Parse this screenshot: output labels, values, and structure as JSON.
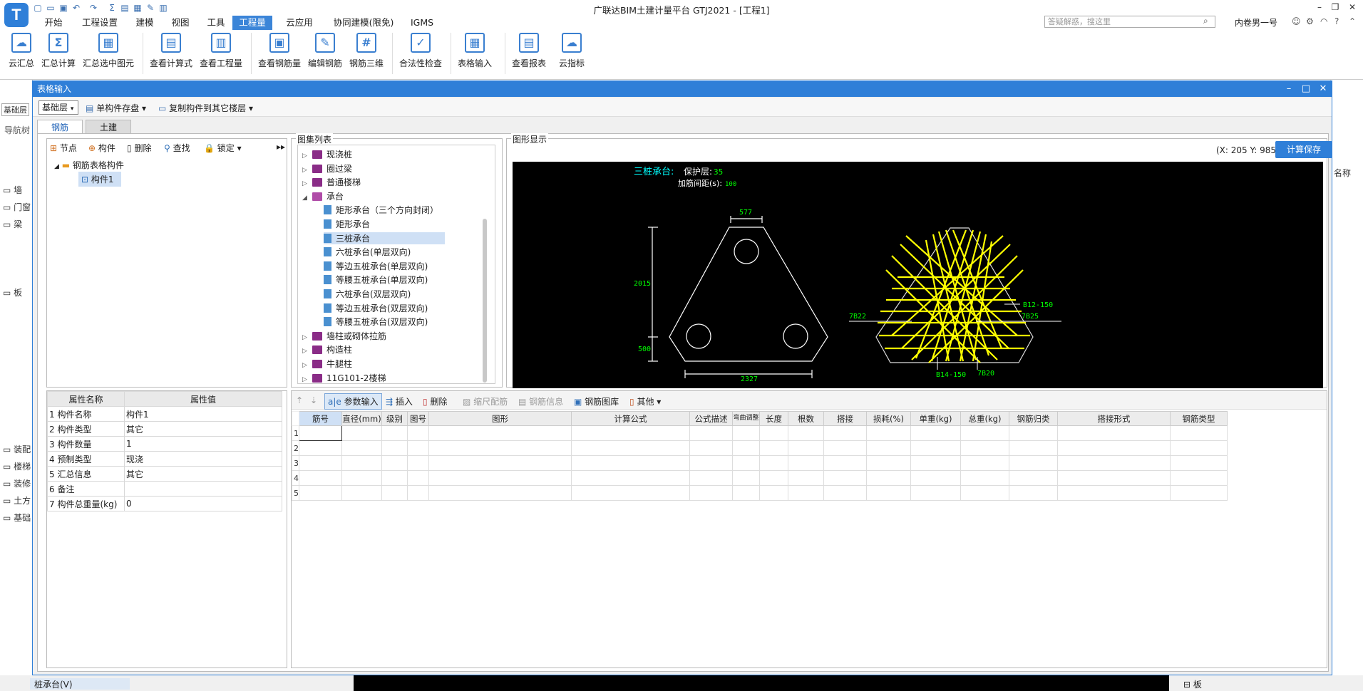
{
  "app": {
    "title": "广联达BIM土建计量平台 GTJ2021 - [工程1]",
    "logo_letter": "T",
    "search_placeholder": "答疑解惑，搜这里",
    "user": "内卷男一号"
  },
  "menu_tabs": [
    "开始",
    "工程设置",
    "建模",
    "视图",
    "工具",
    "工程量",
    "云应用",
    "协同建模(限免)",
    "IGMS"
  ],
  "active_menu": "工程量",
  "ribbon": {
    "items": [
      {
        "label": "云汇总",
        "icon": "cloud-sum-icon"
      },
      {
        "label": "汇总计算",
        "icon": "sigma-icon"
      },
      {
        "label": "汇总选中图元",
        "icon": "sum-selected-icon"
      },
      {
        "label": "查看计算式",
        "icon": "view-formula-icon"
      },
      {
        "label": "查看工程量",
        "icon": "view-quantity-icon"
      },
      {
        "label": "查看钢筋量",
        "icon": "view-rebar-icon"
      },
      {
        "label": "编辑钢筋",
        "icon": "edit-rebar-icon"
      },
      {
        "label": "钢筋三维",
        "icon": "rebar-3d-icon"
      },
      {
        "label": "合法性检查",
        "icon": "check-icon"
      },
      {
        "label": "表格输入",
        "icon": "table-input-icon"
      },
      {
        "label": "查看报表",
        "icon": "report-icon"
      },
      {
        "label": "云指标",
        "icon": "cloud-index-icon"
      }
    ]
  },
  "background_left": {
    "layer": "基础层",
    "nav": "导航树",
    "items": [
      "墙",
      "门窗",
      "梁",
      "板",
      "装配",
      "楼梯",
      "装修",
      "土方",
      "基础"
    ],
    "bottom_item": "桩承台(V)"
  },
  "background_right": {
    "header": "名称",
    "bottom_item": "板"
  },
  "dialog": {
    "title": "表格输入",
    "layer": "基础层",
    "toolbar": [
      "单构件存盘",
      "复制构件到其它楼层"
    ],
    "tabs": [
      "钢筋",
      "土建"
    ],
    "active_tab": "钢筋",
    "tree_toolbar": [
      "节点",
      "构件",
      "删除",
      "查找",
      "锁定"
    ],
    "tree": {
      "root": "钢筋表格构件",
      "child": "构件1"
    },
    "properties": {
      "headers": [
        "属性名称",
        "属性值"
      ],
      "rows": [
        [
          "1 构件名称",
          "构件1"
        ],
        [
          "2 构件类型",
          "其它"
        ],
        [
          "3 构件数量",
          "1"
        ],
        [
          "4 预制类型",
          "现浇"
        ],
        [
          "5 汇总信息",
          "其它"
        ],
        [
          "6 备注",
          ""
        ],
        [
          "7 构件总重量(kg)",
          "0"
        ]
      ]
    },
    "atlas": {
      "title": "图集列表",
      "items": [
        {
          "label": "现浇桩",
          "level": 0,
          "type": "book"
        },
        {
          "label": "圈过梁",
          "level": 0,
          "type": "book"
        },
        {
          "label": "普通楼梯",
          "level": 0,
          "type": "book"
        },
        {
          "label": "承台",
          "level": 0,
          "type": "open"
        },
        {
          "label": "矩形承台（三个方向封闭）",
          "level": 1,
          "type": "page"
        },
        {
          "label": "矩形承台",
          "level": 1,
          "type": "page"
        },
        {
          "label": "三桩承台",
          "level": 1,
          "type": "page"
        },
        {
          "label": "六桩承台(单层双向)",
          "level": 1,
          "type": "page"
        },
        {
          "label": "等边五桩承台(单层双向)",
          "level": 1,
          "type": "page"
        },
        {
          "label": "等腰五桩承台(单层双向)",
          "level": 1,
          "type": "page"
        },
        {
          "label": "六桩承台(双层双向)",
          "level": 1,
          "type": "page"
        },
        {
          "label": "等边五桩承台(双层双向)",
          "level": 1,
          "type": "page"
        },
        {
          "label": "等腰五桩承台(双层双向)",
          "level": 1,
          "type": "page"
        },
        {
          "label": "墙柱或砌体拉筋",
          "level": 0,
          "type": "book"
        },
        {
          "label": "构造柱",
          "level": 0,
          "type": "book"
        },
        {
          "label": "牛腿柱",
          "level": 0,
          "type": "book"
        },
        {
          "label": "11G101-2楼梯",
          "level": 0,
          "type": "book"
        }
      ],
      "selected": "三桩承台"
    },
    "drawing": {
      "title": "图形显示",
      "coords": "(X: 205 Y: 985)",
      "save_button": "计算保存",
      "heading": "三桩承台:",
      "cover_label": "保护层:",
      "cover_value": "35",
      "spacing_label": "加筋间距(s):",
      "spacing_value": "100",
      "dims": {
        "top": "577",
        "height": "2015",
        "base": "500",
        "width": "2327"
      },
      "rebar_labels": [
        "B12-150",
        "7B22",
        "7B25",
        "B14-150",
        "7B20"
      ]
    },
    "rebar_table": {
      "toolbar": [
        {
          "label": "参数输入",
          "enabled": true,
          "active": true
        },
        {
          "label": "插入",
          "enabled": true
        },
        {
          "label": "删除",
          "enabled": true
        },
        {
          "label": "缩尺配筋",
          "enabled": false
        },
        {
          "label": "钢筋信息",
          "enabled": false
        },
        {
          "label": "钢筋图库",
          "enabled": true
        },
        {
          "label": "其他",
          "enabled": true
        }
      ],
      "headers": [
        "筋号",
        "直径(mm)",
        "级别",
        "图号",
        "图形",
        "计算公式",
        "公式描述",
        "弯曲调整",
        "长度",
        "根数",
        "搭接",
        "损耗(%)",
        "单重(kg)",
        "总重(kg)",
        "钢筋归类",
        "搭接形式",
        "钢筋类型"
      ],
      "rows": [
        "1",
        "2",
        "3",
        "4",
        "5"
      ]
    }
  },
  "colors": {
    "accent": "#2f7fd8",
    "canvas_bg": "#000000",
    "rebar": "#ffff00",
    "dim_text": "#00ff00",
    "heading_text": "#00ffff"
  }
}
